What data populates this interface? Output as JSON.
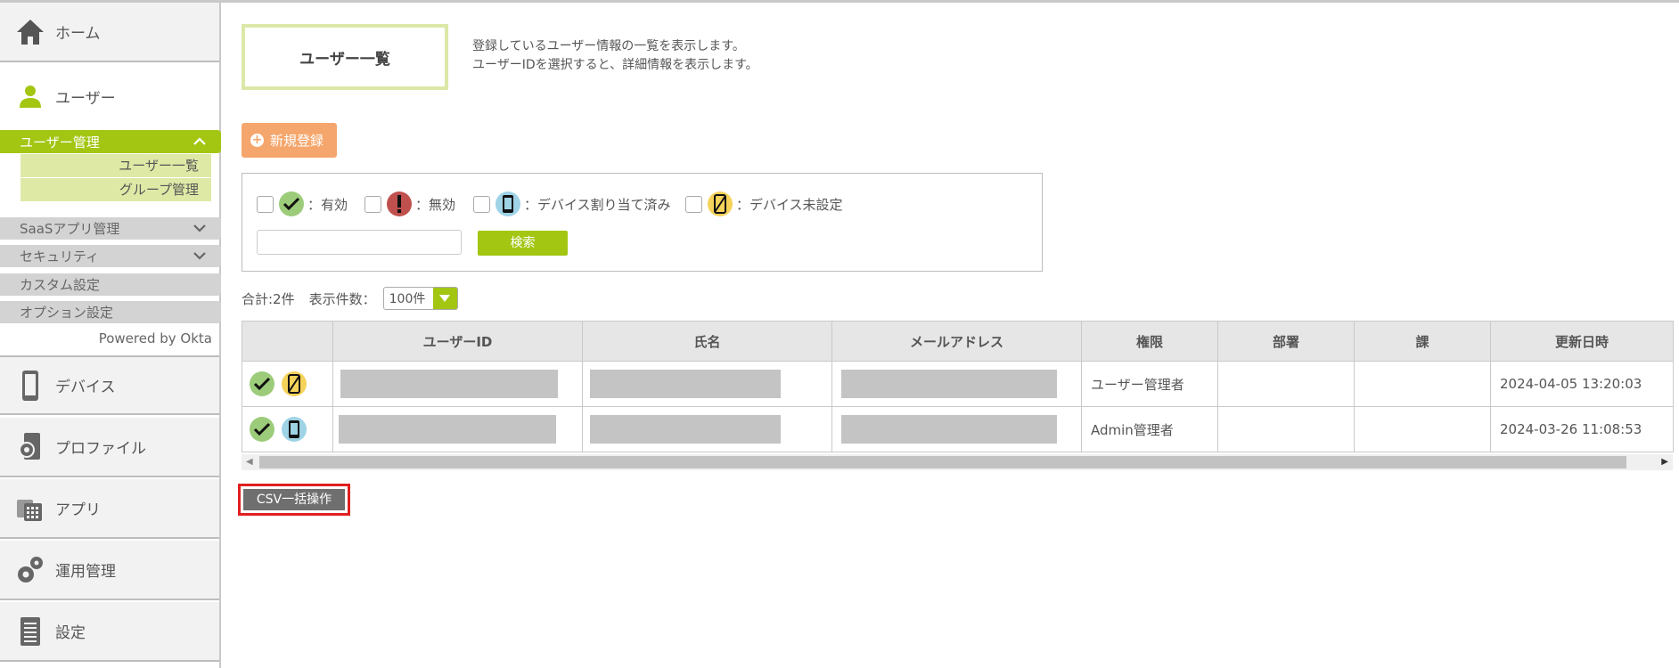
{
  "sidebar": {
    "home": "ホーム",
    "user": "ユーザー",
    "user_management": "ユーザー管理",
    "user_list": "ユーザー一覧",
    "group_management": "グループ管理",
    "saas": "SaaSアプリ管理",
    "security": "セキュリティ",
    "custom": "カスタム設定",
    "options": "オプション設定",
    "powered": "Powered by Okta",
    "device": "デバイス",
    "profile": "プロファイル",
    "apps": "アプリ",
    "operations": "運用管理",
    "settings": "設定"
  },
  "page": {
    "title": "ユーザー一覧",
    "desc1": "登録しているユーザー情報の一覧を表示します。",
    "desc2": "ユーザーIDを選択すると、詳細情報を表示します。",
    "new_button": "新規登録"
  },
  "filter": {
    "active": "：有効",
    "invalid": "：無効",
    "device_assigned": "：デバイス割り当て済み",
    "device_unset": "：デバイス未設定",
    "search_button": "検索"
  },
  "list": {
    "total": "合計:2件",
    "per_page_label": "表示件数：",
    "per_page_value": "100件"
  },
  "table": {
    "headers": [
      "ユーザーID",
      "氏名",
      "メールアドレス",
      "権限",
      "部署",
      "課",
      "更新日時"
    ],
    "rows": [
      {
        "role": "ユーザー管理者",
        "updated": "2024-04-05 13:20:03",
        "status_icons": [
          "check-icon",
          "device-unset-icon"
        ]
      },
      {
        "role": "Admin管理者",
        "updated": "2024-03-26 11:08:53",
        "status_icons": [
          "check-icon",
          "device-assigned-icon"
        ]
      }
    ]
  },
  "csv_button": "CSV一括操作",
  "colors": {
    "accent": "#a3c613",
    "orange": "#f5a66c",
    "check": "#9ccc7a",
    "warn": "#c0504d",
    "device": "#9fd3e6",
    "unset": "#f5d25a",
    "highlight": "#e02020"
  }
}
